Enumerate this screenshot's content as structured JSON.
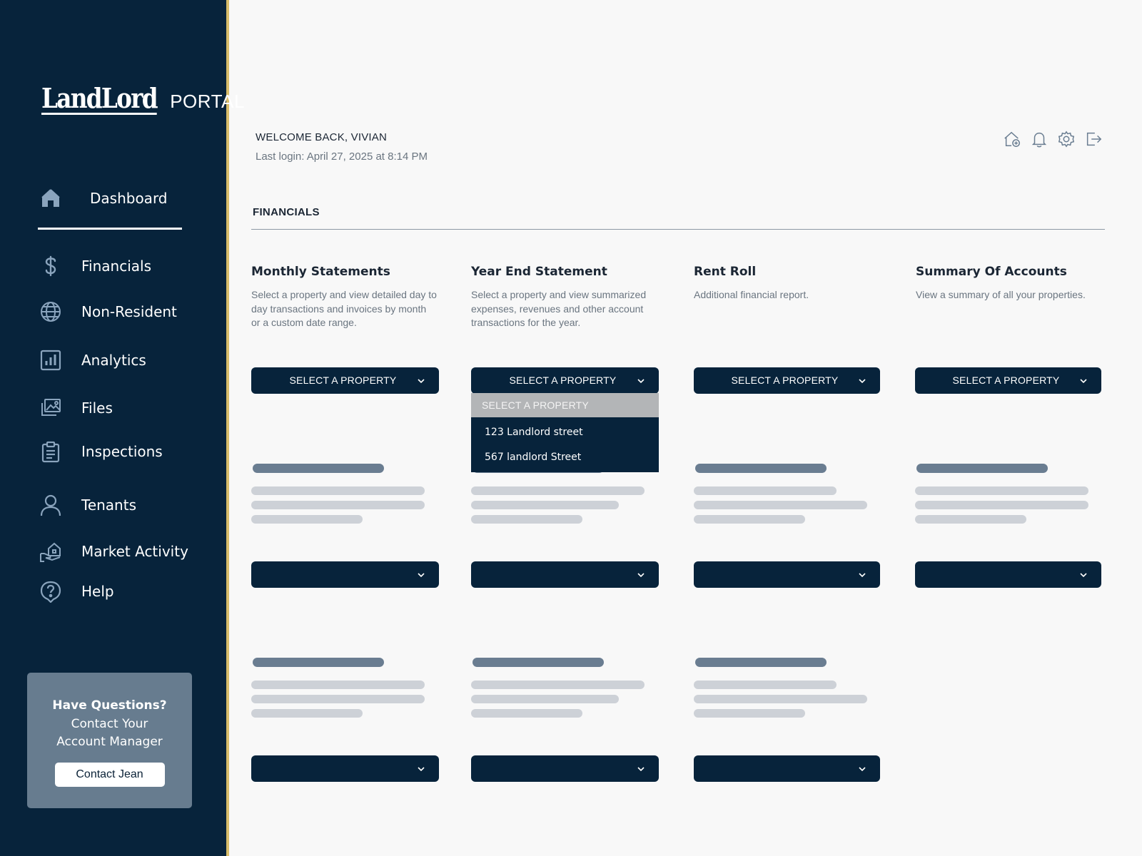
{
  "brand": {
    "name": "LandLord",
    "suffix": "PORTAL"
  },
  "nav": [
    {
      "key": "dashboard",
      "label": "Dashboard",
      "icon": "home-icon"
    },
    {
      "key": "financials",
      "label": "Financials",
      "icon": "dollar-icon"
    },
    {
      "key": "non-resident",
      "label": "Non-Resident",
      "icon": "globe-icon"
    },
    {
      "key": "analytics",
      "label": "Analytics",
      "icon": "bar-chart-icon"
    },
    {
      "key": "files",
      "label": "Files",
      "icon": "images-icon"
    },
    {
      "key": "inspections",
      "label": "Inspections",
      "icon": "clipboard-icon"
    },
    {
      "key": "tenants",
      "label": "Tenants",
      "icon": "user-icon"
    },
    {
      "key": "market-activity",
      "label": "Market Activity",
      "icon": "house-hand-icon"
    },
    {
      "key": "help",
      "label": "Help",
      "icon": "question-icon"
    }
  ],
  "help_card": {
    "title": "Have Questions?",
    "text_line1": "Contact Your",
    "text_line2": "Account Manager",
    "button": "Contact Jean"
  },
  "header": {
    "welcome": "WELCOME BACK, VIVIAN",
    "last_login": "Last login: April 27, 2025 at 8:14 PM",
    "icons": [
      "home-add-icon",
      "bell-icon",
      "gear-icon",
      "logout-icon"
    ]
  },
  "section": {
    "title": "FINANCIALS"
  },
  "columns": [
    {
      "title": "Monthly Statements",
      "desc": "Select a property and view detailed day to day transactions and invoices by month or a custom date range.",
      "select": "SELECT A PROPERTY"
    },
    {
      "title": "Year End Statement",
      "desc": "Select a property and view summarized expenses, revenues and other account transactions for the year.",
      "select": "SELECT A PROPERTY"
    },
    {
      "title": "Rent Roll",
      "desc": "Additional financial report.",
      "select": "SELECT A PROPERTY"
    },
    {
      "title": "Summary Of Accounts",
      "desc": "View a summary of all your properties.",
      "select": "SELECT A PROPERTY"
    }
  ],
  "dropdown": {
    "header": "SELECT A PROPERTY",
    "options": [
      "123 Landlord street",
      "567 landlord Street"
    ]
  },
  "colors": {
    "navy": "#07233b",
    "gold": "#d8bd6a",
    "slate": "#677c8f",
    "skeleton_dark": "#6a7d91",
    "skeleton_light": "#cdd1d7"
  }
}
